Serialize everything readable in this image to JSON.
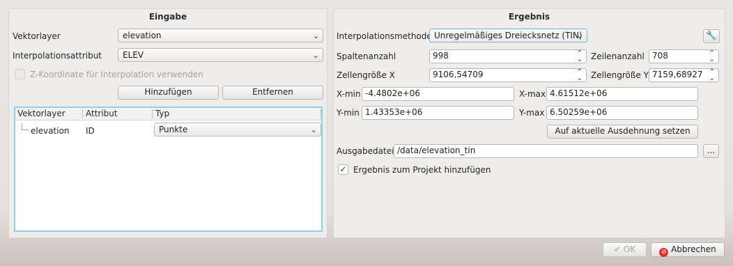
{
  "eingabe": {
    "title": "Eingabe",
    "vektorlayer_label": "Vektorlayer",
    "vektorlayer_value": "elevation",
    "attribut_label": "Interpolationsattribut",
    "attribut_value": "ELEV",
    "zkoord_label": "Z-Koordinate für Interpolation verwenden",
    "add_label": "Hinzufügen",
    "remove_label": "Entfernen",
    "table": {
      "headers": [
        "Vektorlayer",
        "Attribut",
        "Typ"
      ],
      "rows": [
        {
          "layer": "elevation",
          "attribut": "ID",
          "typ": "Punkte"
        }
      ]
    }
  },
  "ergebnis": {
    "title": "Ergebnis",
    "method_label": "Interpolationsmethode",
    "method_value": "Unregelmäßiges Dreiecksnetz (TIN)",
    "settings_icon": "wrench-icon",
    "spalten_label": "Spaltenanzahl",
    "spalten_value": "998",
    "zeilen_label": "Zeilenanzahl",
    "zeilen_value": "708",
    "zellx_label": "Zellengröße X",
    "zellx_value": "9106,54709",
    "zelly_label": "Zellengröße Y",
    "zelly_value": "7159,68927",
    "xmin_label": "X-min",
    "xmin_value": "-4.4802e+06",
    "xmax_label": "X-max",
    "xmax_value": "4.61512e+06",
    "ymin_label": "Y-min",
    "ymin_value": "1.43353e+06",
    "ymax_label": "Y-max",
    "ymax_value": "6.50259e+06",
    "extent_label": "Auf aktuelle Ausdehnung setzen",
    "output_label": "Ausgabedatei",
    "output_value": "/data/elevation_tin",
    "browse_label": "...",
    "add_to_project_label": "Ergebnis zum Projekt hinzufügen"
  },
  "footer": {
    "ok_label": "OK",
    "cancel_label": "Abbrechen"
  },
  "colors": {
    "tree_focus_border": "#8fd0ee",
    "cancel_icon": "#d9322b"
  }
}
